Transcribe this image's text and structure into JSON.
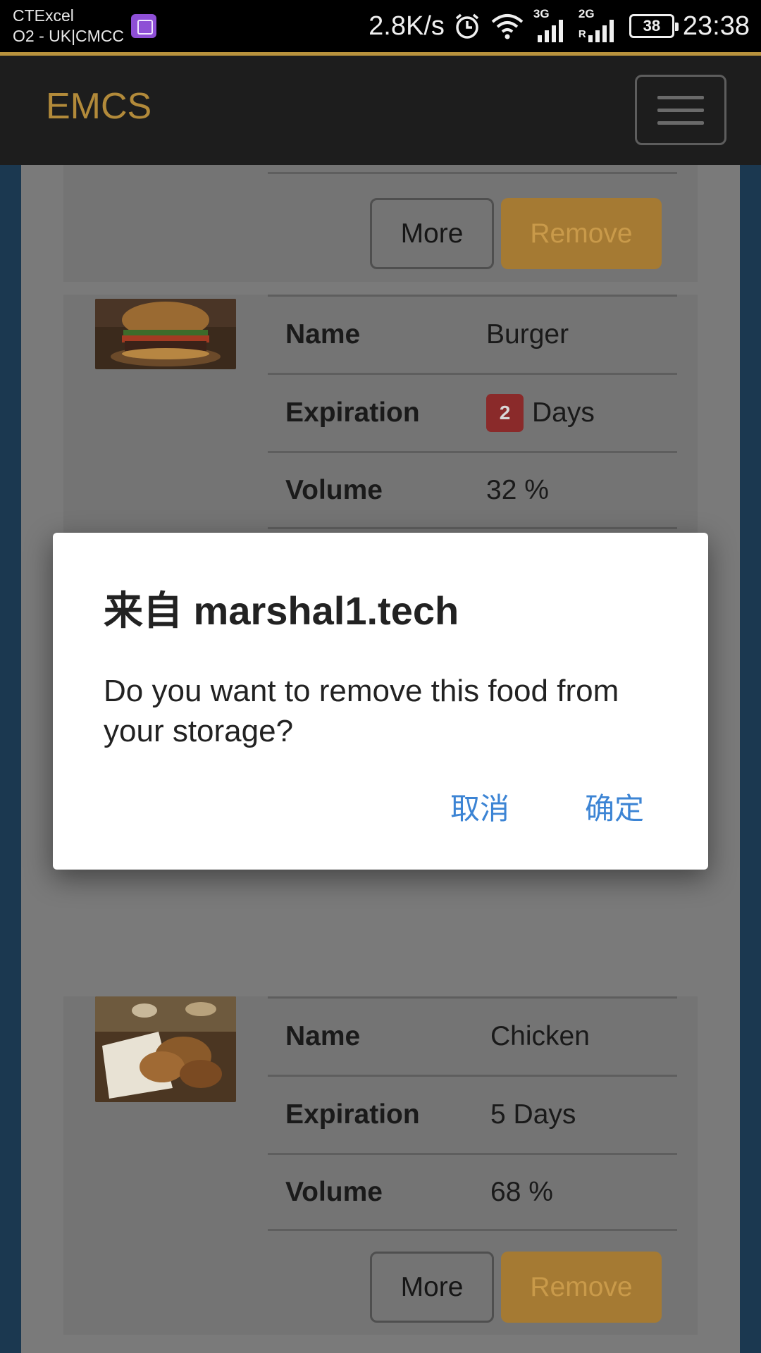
{
  "status_bar": {
    "carrier_line1": "CTExcel",
    "carrier_line2": "O2 - UK|CMCC",
    "net_speed": "2.8K/s",
    "network_3g": "3G",
    "network_2g": "2G",
    "roaming": "R",
    "battery": "38",
    "time": "23:38",
    "icons": [
      "gallery-icon",
      "alarm-icon",
      "wifi-icon",
      "signal-icon",
      "battery-icon"
    ]
  },
  "navbar": {
    "brand": "EMCS",
    "toggler_icon": "hamburger-icon",
    "brand_color": "#b28a3a"
  },
  "labels": {
    "name": "Name",
    "expiration": "Expiration",
    "volume": "Volume",
    "more": "More",
    "remove": "Remove"
  },
  "foods": [
    {
      "name": "Burger",
      "expiration_days": "2",
      "expiration_unit": "Days",
      "expiration_urgent": true,
      "volume": "32 %",
      "image": "burger-photo"
    },
    {
      "name": "Chicken",
      "expiration_text": "5 Days",
      "expiration_urgent": false,
      "volume": "68 %",
      "image": "fried-chicken-photo"
    }
  ],
  "dialog": {
    "title": "来自 marshal1.tech",
    "message": "Do you want to remove this food from your storage?",
    "cancel": "取消",
    "ok": "确定"
  },
  "colors": {
    "accent_gold": "#b8923d",
    "remove_button": "#a57a33",
    "badge_danger": "#8a2a2a",
    "dialog_button": "#3c84d4"
  }
}
